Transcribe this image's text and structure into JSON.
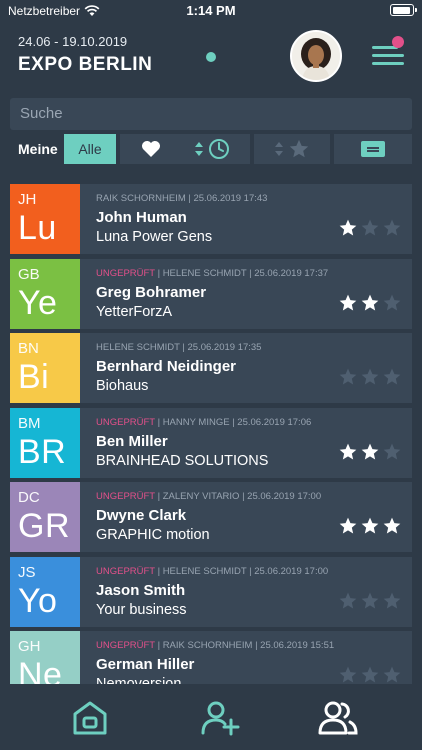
{
  "status_bar": {
    "carrier": "Netzbetreiber",
    "time": "1:14 PM"
  },
  "header": {
    "date_range": "24.06 - 19.10.2019",
    "title": "EXPO BERLIN"
  },
  "search": {
    "placeholder": "Suche"
  },
  "filter": {
    "label": "Meine",
    "active_option": "Alle"
  },
  "contacts": [
    {
      "initials": "JH",
      "abbr": "Lu",
      "tile_color": "#f25f1e",
      "flag": "",
      "meta": "RAIK SCHORNHEIM | 25.06.2019 17:43",
      "name": "John Human",
      "company": "Luna Power Gens",
      "rating": 1
    },
    {
      "initials": "GB",
      "abbr": "Ye",
      "tile_color": "#7bc043",
      "flag": "UNGEPRÜFT",
      "meta": " | HELENE SCHMIDT | 25.06.2019 17:37",
      "name": "Greg Bohramer",
      "company": "YetterForzA",
      "rating": 2
    },
    {
      "initials": "BN",
      "abbr": "Bi",
      "tile_color": "#f7c948",
      "flag": "",
      "meta": "HELENE SCHMIDT | 25.06.2019 17:35",
      "name": "Bernhard Neidinger",
      "company": "Biohaus",
      "rating": 0
    },
    {
      "initials": "BM",
      "abbr": "BR",
      "tile_color": "#16b6d4",
      "flag": "UNGEPRÜFT",
      "meta": " | HANNY MINGE | 25.06.2019 17:06",
      "name": "Ben Miller",
      "company": "BRAINHEAD SOLUTIONS",
      "rating": 2
    },
    {
      "initials": "DC",
      "abbr": "GR",
      "tile_color": "#9b86b8",
      "flag": "UNGEPRÜFT",
      "meta": " | ZALENY VITARIO | 25.06.2019 17:00",
      "name": "Dwyne Clark",
      "company": "GRAPHIC motion",
      "rating": 3
    },
    {
      "initials": "JS",
      "abbr": "Yo",
      "tile_color": "#3a8fdc",
      "flag": "UNGEPRÜFT",
      "meta": " | HELENE SCHMIDT | 25.06.2019 17:00",
      "name": "Jason Smith",
      "company": "Your business",
      "rating": 0
    },
    {
      "initials": "GH",
      "abbr": "Ne",
      "tile_color": "#95cfc6",
      "flag": "UNGEPRÜFT",
      "meta": " | RAIK SCHORNHEIM | 25.06.2019 15:51",
      "name": "German Hiller",
      "company": "Nemoversion",
      "rating": 0
    }
  ],
  "colors": {
    "accent": "#6ecfc0",
    "badge": "#e2508a",
    "background": "#2e3a47",
    "card": "#394756",
    "star_on": "#ffffff",
    "star_off": "#4f5f70"
  },
  "icons": [
    "wifi-icon",
    "battery-icon",
    "menu-icon",
    "heart-icon",
    "clock-icon",
    "star-icon",
    "sort-icon",
    "card-icon",
    "home-icon",
    "add-user-icon",
    "users-icon"
  ]
}
